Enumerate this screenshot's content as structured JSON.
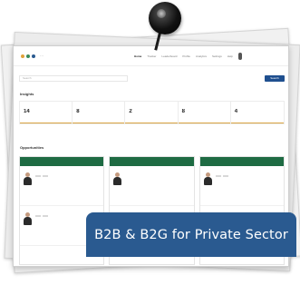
{
  "banner": {
    "text": "B2B & B2G for Private Sector"
  },
  "topbar": {
    "logo_text": "···",
    "nav": [
      "Home",
      "Tracker",
      "Leaderboard",
      "Profile",
      "Analytics",
      "Settings",
      "Help"
    ]
  },
  "search": {
    "placeholder": "Search",
    "button": "Search"
  },
  "insights": {
    "title": "Insights",
    "stats": [
      {
        "label": "",
        "value": "14"
      },
      {
        "label": "",
        "value": "8"
      },
      {
        "label": "",
        "value": "2"
      },
      {
        "label": "",
        "value": "8"
      },
      {
        "label": "",
        "value": "4"
      }
    ]
  },
  "opportunities": {
    "title": "Opportunities",
    "columns": [
      {
        "title": "",
        "cards": [
          {
            "name": "",
            "tags": [
              "",
              ""
            ],
            "meta": ""
          },
          {
            "name": "",
            "tags": [
              "",
              ""
            ],
            "meta": ""
          }
        ]
      },
      {
        "title": "",
        "cards": [
          {
            "name": "",
            "tags": [],
            "meta": ""
          },
          {
            "name": "",
            "tags": [],
            "meta": ""
          }
        ]
      },
      {
        "title": "",
        "cards": [
          {
            "name": "",
            "tags": [
              "",
              ""
            ],
            "meta": ""
          },
          {
            "name": "",
            "tags": [
              "",
              ""
            ],
            "meta": ""
          }
        ]
      }
    ]
  },
  "colors": {
    "banner": "#2a5a90",
    "column_header": "#1e6b43",
    "stat_accent": "#d9a441",
    "search_button": "#1f4f8f",
    "pin": "#111111"
  },
  "icons": {
    "pin": "pushpin-icon",
    "avatar": "person-avatar-icon"
  }
}
